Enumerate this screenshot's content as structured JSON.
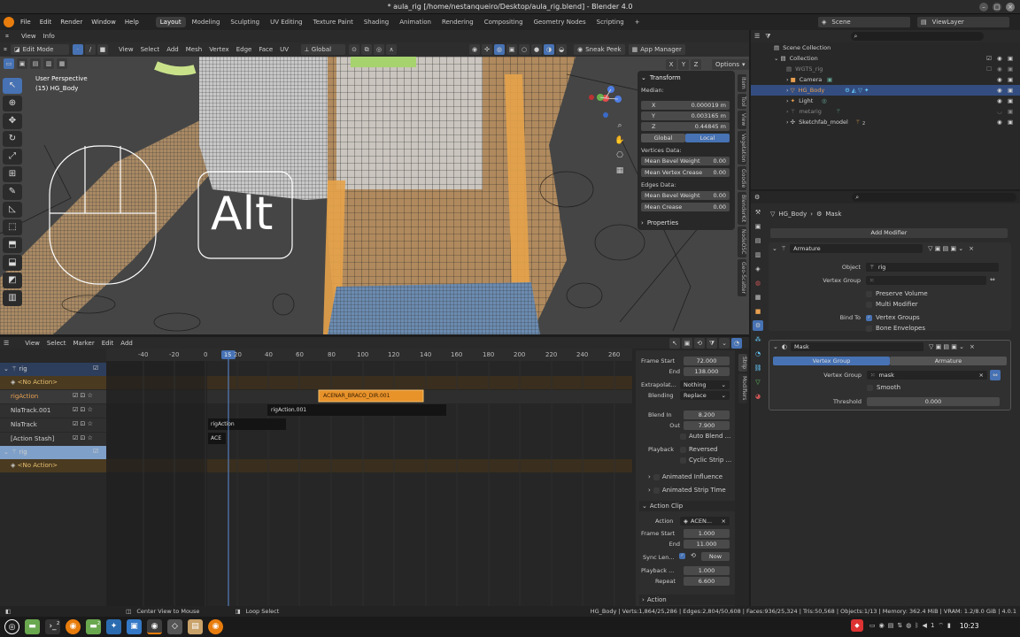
{
  "window": {
    "title": "* aula_rig [/home/nestanqueiro/Desktop/aula_rig.blend] - Blender 4.0",
    "btn_min": "–",
    "btn_max": "□",
    "btn_close": "×"
  },
  "topbar": {
    "menus": [
      "File",
      "Edit",
      "Render",
      "Window",
      "Help"
    ],
    "workspaces": [
      "Layout",
      "Modeling",
      "Sculpting",
      "UV Editing",
      "Texture Paint",
      "Shading",
      "Animation",
      "Rendering",
      "Compositing",
      "Geometry Nodes",
      "Scripting"
    ],
    "add_ws": "+",
    "scene": "Scene",
    "viewlayer": "ViewLayer"
  },
  "viewport_header": {
    "mode": "Edit Mode",
    "menus": [
      "View",
      "Select",
      "Add",
      "Mesh",
      "Vertex",
      "Edge",
      "Face",
      "UV"
    ],
    "orientation": "Global",
    "sneak_peek": "Sneak Peek",
    "app_manager": "App Manager",
    "options": "Options",
    "axes": [
      "X",
      "Y",
      "Z"
    ]
  },
  "viewport": {
    "perspective": "User Perspective",
    "object": "(15) HG_Body",
    "overlay_key": "Alt"
  },
  "npanel": {
    "title": "Transform",
    "median": "Median:",
    "x_label": "X",
    "x": "0.000019 m",
    "y_label": "Y",
    "y": "0.003165 m",
    "z_label": "Z",
    "z": "0.44845 m",
    "global": "Global",
    "local": "Local",
    "vertices_data": "Vertices Data:",
    "mean_bevel_weight": "Mean Bevel Weight",
    "mbw_val": "0.00",
    "mean_vertex_crease": "Mean Vertex Crease",
    "mvc_val": "0.00",
    "edges_data": "Edges Data:",
    "mean_bevel_weight2": "Mean Bevel Weight",
    "mbw2_val": "0.00",
    "mean_crease": "Mean Crease",
    "mc_val": "0.00",
    "properties": "Properties",
    "tabs": [
      "Item",
      "Tool",
      "View",
      "Vegetation",
      "Goodie",
      "BlenderKit",
      "NodeOSC",
      "Geo-Scatter"
    ]
  },
  "outliner": {
    "search": "",
    "rows": [
      {
        "label": "Scene Collection",
        "indent": 0
      },
      {
        "label": "Collection",
        "indent": 1
      },
      {
        "label": "WGTS_rig",
        "indent": 2
      },
      {
        "label": "Camera",
        "indent": 2
      },
      {
        "label": "HG_Body",
        "indent": 2,
        "selected": true
      },
      {
        "label": "Light",
        "indent": 2
      },
      {
        "label": "metarig",
        "indent": 2
      },
      {
        "label": "Sketchfab_model",
        "indent": 2
      }
    ],
    "sketch_count": "2"
  },
  "properties": {
    "breadcrumb_obj": "HG_Body",
    "breadcrumb_mod": "Mask",
    "add_modifier": "Add Modifier",
    "armature": {
      "name": "Armature",
      "object_label": "Object",
      "object": "rig",
      "vgroup_label": "Vertex Group",
      "vgroup": "",
      "preserve_volume": "Preserve Volume",
      "multi_modifier": "Multi Modifier",
      "bind_to": "Bind To",
      "vertex_groups": "Vertex Groups",
      "bone_envelopes": "Bone Envelopes"
    },
    "mask": {
      "name": "Mask",
      "tab_vg": "Vertex Group",
      "tab_arm": "Armature",
      "vgroup_label": "Vertex Group",
      "vgroup": "mask",
      "smooth": "Smooth",
      "threshold_label": "Threshold",
      "threshold": "0.000"
    }
  },
  "nla_header": {
    "menus": [
      "View",
      "Select",
      "Marker",
      "Edit",
      "Add"
    ]
  },
  "nla": {
    "ruler": [
      "-40",
      "-20",
      "0",
      "20",
      "40",
      "60",
      "80",
      "100",
      "120",
      "140",
      "160",
      "180",
      "200",
      "220",
      "240",
      "260"
    ],
    "current_frame": "15",
    "tracks": [
      {
        "label": "rig",
        "type": "object"
      },
      {
        "label": "<No Action>",
        "type": "action"
      },
      {
        "label": "rigAction",
        "type": "track"
      },
      {
        "label": "NlaTrack.001",
        "type": "track"
      },
      {
        "label": "NlaTrack",
        "type": "track"
      },
      {
        "label": "[Action Stash]",
        "type": "track"
      },
      {
        "label": "rig",
        "type": "object-sel"
      },
      {
        "label": "<No Action>",
        "type": "action"
      }
    ],
    "strip_orange": "ACENAR_BRACO_DIR.001",
    "strip_dark1": "rigAction.001",
    "strip_dark2": "rigAction",
    "strip_ace": "ACE"
  },
  "strip_panel": {
    "frame_start_label": "Frame Start",
    "frame_start": "72.000",
    "end_label": "End",
    "end": "138.000",
    "extrapolation_label": "Extrapolat...",
    "extrapolation": "Nothing",
    "blending_label": "Blending",
    "blending": "Replace",
    "blend_in_label": "Blend In",
    "blend_in": "8.200",
    "out_label": "Out",
    "out": "7.900",
    "auto_blend": "Auto Blend ...",
    "playback_label": "Playback",
    "reversed": "Reversed",
    "cyclic": "Cyclic Strip ...",
    "animated_influence": "Animated Influence",
    "animated_strip_time": "Animated Strip Time",
    "action_clip": "Action Clip",
    "action_label": "Action",
    "action": "ACEN...",
    "ac_frame_start_label": "Frame Start",
    "ac_frame_start": "1.000",
    "ac_end_label": "End",
    "ac_end": "11.000",
    "sync_len": "Sync Len...",
    "now": "Now",
    "playback_scale_label": "Playback ...",
    "playback_scale": "1.000",
    "repeat_label": "Repeat",
    "repeat": "6.600",
    "action_section": "Action",
    "tabs": [
      "Strip",
      "Modifiers"
    ]
  },
  "statusbar": {
    "center": "Center View to Mouse",
    "loop": "Loop Select",
    "stats": "HG_Body | Verts:1,864/25,286 | Edges:2,804/50,608 | Faces:936/25,324 | Tris:50,568 | Objects:1/13 | Memory: 362.4 MiB | VRAM: 1.2/8.0 GiB | 4.0.1"
  },
  "taskbar": {
    "badge1": "2",
    "badge2": "2",
    "clock": "10:23",
    "vol": "1"
  },
  "colors": {
    "accent": "#4772b3",
    "orange": "#e8922a",
    "bg": "#1d1d1d"
  }
}
